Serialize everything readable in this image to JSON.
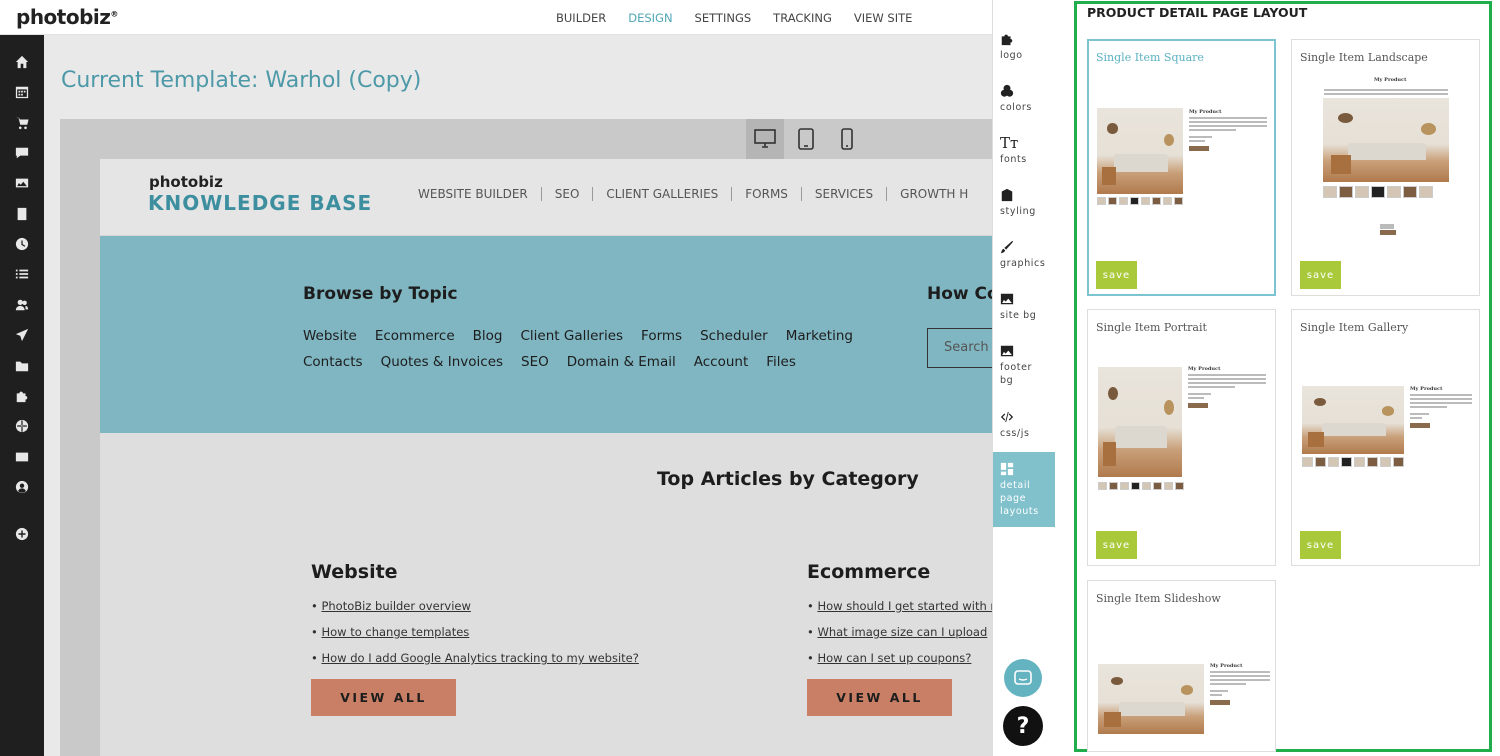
{
  "app": {
    "logo": "photobiz",
    "nav": [
      "BUILDER",
      "DESIGN",
      "SETTINGS",
      "TRACKING",
      "VIEW SITE"
    ],
    "active_nav": "DESIGN"
  },
  "sidebar_icons": [
    "home-icon",
    "calendar-grid-icon",
    "cart-icon",
    "chat-icon",
    "gallery-icon",
    "document-icon",
    "clock-icon",
    "list-icon",
    "users-icon",
    "send-icon",
    "folder-icon",
    "puzzle-icon",
    "globe-icon",
    "mail-icon",
    "account-icon",
    "add-icon"
  ],
  "template": {
    "title": "Current Template: Warhol (Copy)"
  },
  "site": {
    "logo_top": "photobiz",
    "logo_bottom": "KNOWLEDGE BASE",
    "nav": [
      "WEBSITE BUILDER",
      "SEO",
      "CLIENT GALLERIES",
      "FORMS",
      "SERVICES",
      "GROWTH H"
    ],
    "browse_title": "Browse by Topic",
    "topics": [
      "Website",
      "Ecommerce",
      "Blog",
      "Client Galleries",
      "Forms",
      "Scheduler",
      "Marketing",
      "Contacts",
      "Quotes & Invoices",
      "SEO",
      "Domain & Email",
      "Account",
      "Files"
    ],
    "how_title": "How Co",
    "search_placeholder": "Search",
    "top_articles": "Top Articles by Category",
    "columns": [
      {
        "title": "Website",
        "links": [
          "PhotoBiz builder overview",
          "How to change templates",
          "How do I add Google Analytics tracking to my website?"
        ],
        "button": "VIEW ALL"
      },
      {
        "title": "Ecommerce",
        "links": [
          "How should I get started with n",
          "What image size can I upload",
          "How can I set up coupons?"
        ],
        "button": "VIEW ALL"
      }
    ]
  },
  "tools": [
    {
      "label": "logo",
      "icon": "puzzle-icon"
    },
    {
      "label": "colors",
      "icon": "color-circles-icon"
    },
    {
      "label": "fonts",
      "icon": "text-icon"
    },
    {
      "label": "styling",
      "icon": "building-icon"
    },
    {
      "label": "graphics",
      "icon": "brush-icon"
    },
    {
      "label": "site bg",
      "icon": "image-icon"
    },
    {
      "label": "footer bg",
      "icon": "image-icon"
    },
    {
      "label": "css/js",
      "icon": "code-icon"
    },
    {
      "label": "detail page layouts",
      "icon": "layout-icon",
      "active": true
    }
  ],
  "panel": {
    "title": "PRODUCT DETAIL PAGE LAYOUT",
    "product_name": "My Product",
    "layouts": [
      {
        "name": "Single Item Square",
        "save": "save",
        "selected": true
      },
      {
        "name": "Single Item Landscape",
        "save": "save"
      },
      {
        "name": "Single Item Portrait",
        "save": "save"
      },
      {
        "name": "Single Item Gallery",
        "save": "save"
      },
      {
        "name": "Single Item Slideshow",
        "save": "save"
      }
    ]
  },
  "colors": {
    "accent": "#4fa6b5",
    "hero": "#7fb6c2",
    "save": "#a9c93b",
    "highlight_border": "#21ad4b",
    "viewall": "#c97f66"
  }
}
